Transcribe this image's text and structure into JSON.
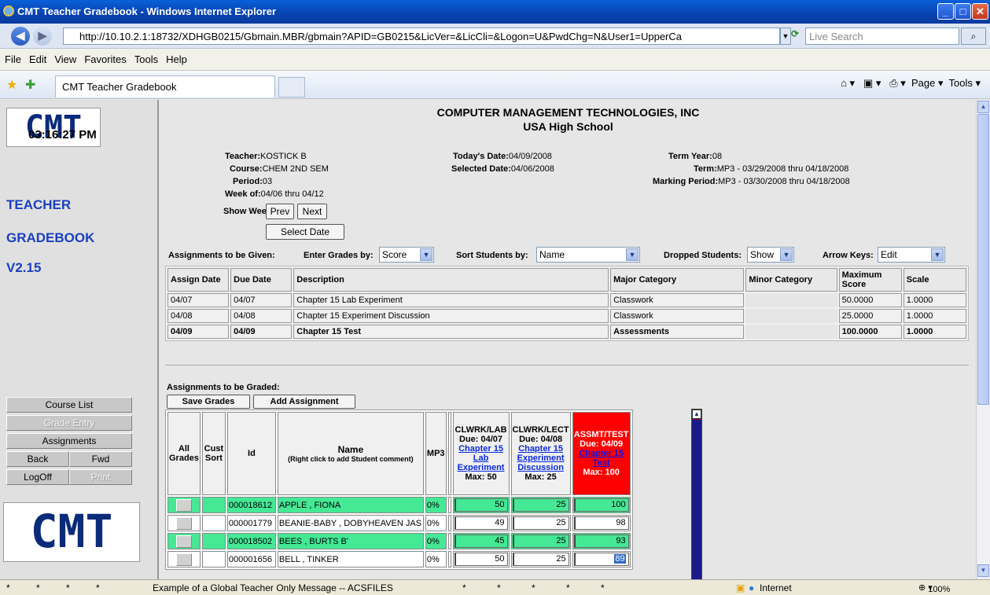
{
  "window": {
    "title": "CMT Teacher Gradebook - Windows Internet Explorer"
  },
  "address": {
    "url": "http://10.10.2.1:18732/XDHGB0215/Gbmain.MBR/gbmain?APID=GB0215&LicVer=&LicCli=&Logon=U&PwdChg=N&User1=UpperCa",
    "search_placeholder": "Live Search"
  },
  "menu": [
    "File",
    "Edit",
    "View",
    "Favorites",
    "Tools",
    "Help"
  ],
  "tab": {
    "label": "CMT Teacher Gradebook"
  },
  "toolbar": {
    "page": "Page",
    "tools": "Tools"
  },
  "sidebar": {
    "logo": "CMT",
    "time": "03:16:27 PM",
    "line1": "TEACHER",
    "line2": "GRADEBOOK",
    "version": "V2.15",
    "buttons": {
      "course_list": "Course List",
      "grade_entry": "Grade Entry",
      "assignments": "Assignments",
      "back": "Back",
      "fwd": "Fwd",
      "logoff": "LogOff",
      "print": "Print"
    }
  },
  "header": {
    "company": "COMPUTER MANAGEMENT TECHNOLOGIES, INC",
    "school": "USA High School"
  },
  "info": {
    "teacher_l": "Teacher:",
    "teacher": "KOSTICK B",
    "course_l": "Course:",
    "course": "CHEM 2ND SEM",
    "period_l": "Period:",
    "period": "03",
    "week_l": "Week of:",
    "week": "04/06 thru 04/12",
    "today_l": "Today's Date:",
    "today": "04/09/2008",
    "selected_l": "Selected Date:",
    "selected": "04/06/2008",
    "termyear_l": "Term Year:",
    "termyear": "08",
    "term_l": "Term:",
    "term": "MP3 - 03/29/2008 thru 04/18/2008",
    "mp_l": "Marking Period:",
    "mp": "MP3 - 03/30/2008 thru 04/18/2008",
    "showweek_l": "Show Week:",
    "prev": "Prev",
    "next": "Next",
    "selectdate": "Select Date"
  },
  "controls": {
    "given_l": "Assignments to be Given:",
    "enter_l": "Enter Grades by:",
    "enter": "Score",
    "sort_l": "Sort Students by:",
    "sort": "Name",
    "dropped_l": "Dropped Students:",
    "dropped": "Show",
    "arrow_l": "Arrow Keys:",
    "arrow": "Edit"
  },
  "assign_headers": [
    "Assign Date",
    "Due Date",
    "Description",
    "Major Category",
    "Minor Category",
    "Maximum Score",
    "Scale"
  ],
  "assignments": [
    [
      "04/07",
      "04/07",
      "Chapter 15 Lab Experiment",
      "Classwork",
      "",
      "50.0000",
      "1.0000"
    ],
    [
      "04/08",
      "04/08",
      "Chapter 15 Experiment Discussion",
      "Classwork",
      "",
      "25.0000",
      "1.0000"
    ],
    [
      "04/09",
      "04/09",
      "Chapter 15 Test",
      "Assessments",
      "",
      "100.0000",
      "1.0000"
    ]
  ],
  "graded": {
    "title": "Assignments to be Graded:",
    "save": "Save Grades",
    "add": "Add Assignment",
    "h_all": "All Grades",
    "h_cust": "Cust Sort",
    "h_id": "Id",
    "h_name": "Name",
    "h_name_sub": "(Right click to add Student comment)",
    "h_mp": "MP3",
    "cols": [
      {
        "cat": "CLWRK/LAB",
        "due": "Due: 04/07",
        "link": "Chapter 15 Lab Experiment",
        "max": "Max: 50"
      },
      {
        "cat": "CLWRK/LECT",
        "due": "Due: 04/08",
        "link": "Chapter 15 Experiment Discussion",
        "max": "Max: 25"
      },
      {
        "cat": "ASSMT/TEST",
        "due": "Due: 04/09",
        "link": "Chapter 15 Test",
        "max": "Max: 100"
      }
    ],
    "students": [
      {
        "id": "000018612",
        "name": "APPLE , FIONA",
        "mp": "0%",
        "g": [
          "50",
          "25",
          "100"
        ]
      },
      {
        "id": "000001779",
        "name": "BEANIE-BABY , DOBYHEAVEN JAS",
        "mp": "0%",
        "g": [
          "49",
          "25",
          "98"
        ]
      },
      {
        "id": "000018502",
        "name": "BEES , BURTS B'",
        "mp": "0%",
        "g": [
          "45",
          "25",
          "93"
        ]
      },
      {
        "id": "000001656",
        "name": "BELL , TINKER",
        "mp": "0%",
        "g": [
          "50",
          "25",
          "89"
        ]
      }
    ]
  },
  "status": {
    "stars": "*",
    "message": "Example of a Global Teacher Only Message -- ACSFILES",
    "zone": "Internet",
    "zoom": "100%"
  }
}
